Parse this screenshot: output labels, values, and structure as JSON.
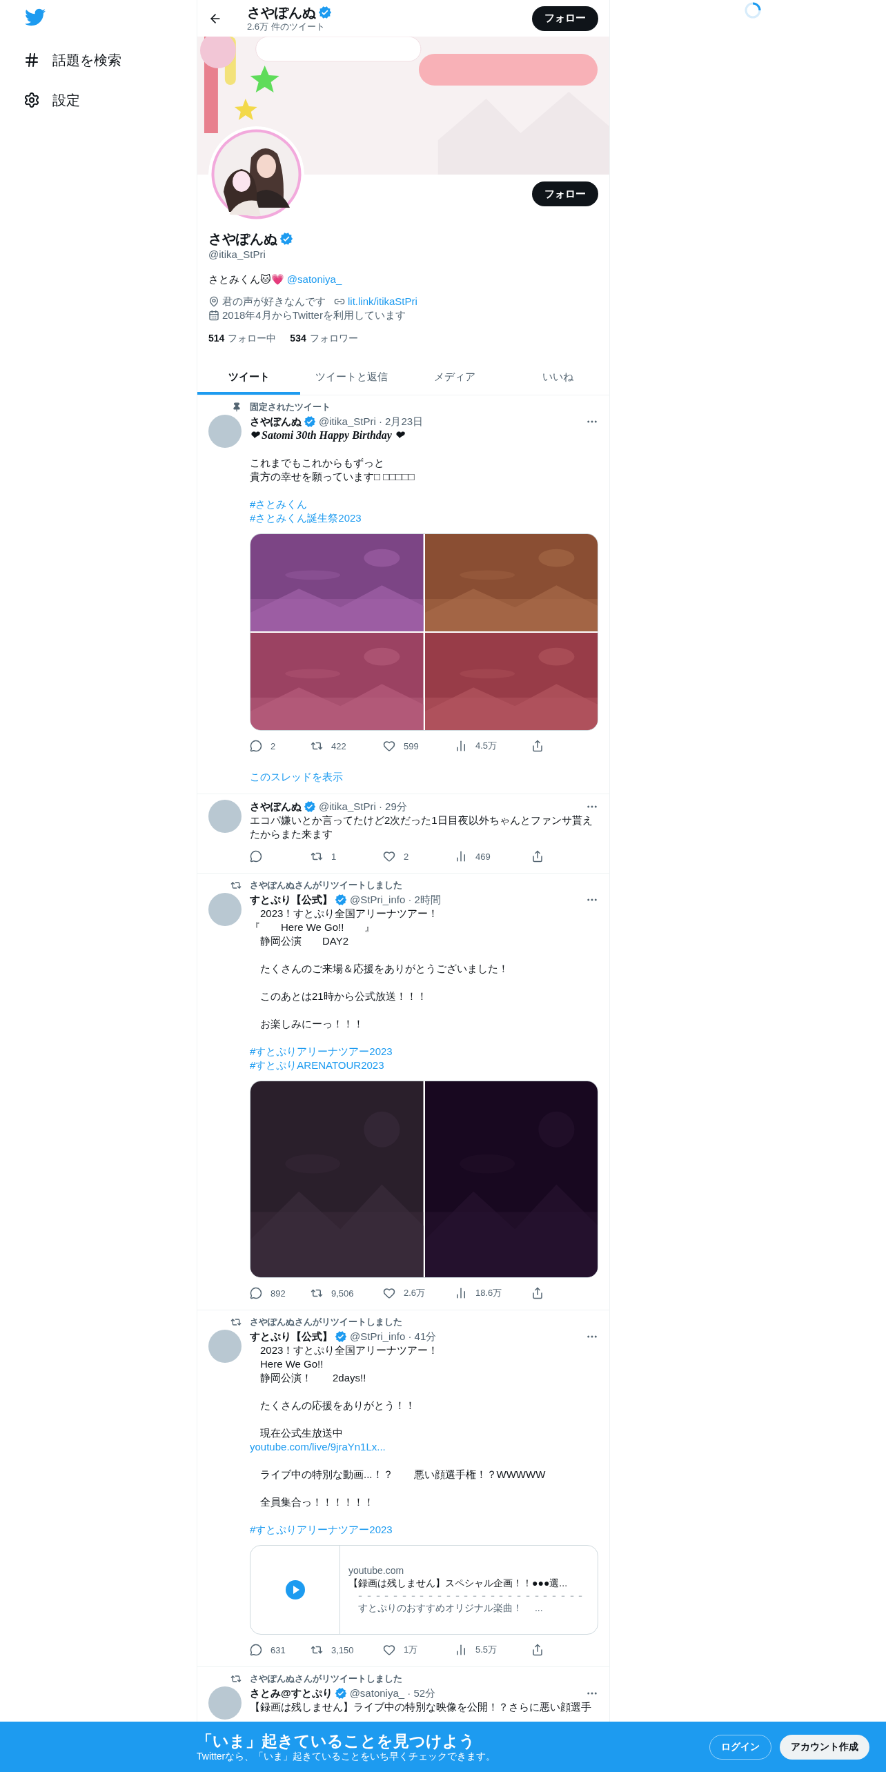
{
  "sidebar": {
    "items": [
      {
        "kind": "hash",
        "label": "話題を検索"
      },
      {
        "kind": "settings",
        "label": "設定"
      }
    ]
  },
  "header": {
    "title": "さやぽんぬ",
    "verified": true,
    "subtitle": "2.6万 件のツイート",
    "follow_button": "フォロー"
  },
  "profile": {
    "follow_button": "フォロー",
    "name": "さやぽんぬ",
    "verified": true,
    "handle": "@itika_StPri",
    "bio": "さとみくん🐱💗 ",
    "bio_mention": "@satoniya_",
    "location": "君の声が好きなんです",
    "website": "lit.link/itikaStPri",
    "joined": "2018年4月からTwitterを利用しています",
    "following_count": "514",
    "following_label": "フォロー中",
    "followers_count": "534",
    "followers_label": "フォロワー"
  },
  "tabs": [
    {
      "label": "ツイート",
      "selected": true
    },
    {
      "label": "ツイートと返信",
      "selected": false
    },
    {
      "label": "メディア",
      "selected": false
    },
    {
      "label": "いいね",
      "selected": false
    }
  ],
  "tweets": [
    {
      "context": {
        "kind": "pinned",
        "text": "固定されたツイート"
      },
      "author": {
        "name": "さやぽんぬ",
        "verified": true
      },
      "meta": "@itika_StPri · 2月23日",
      "paragraphs": [
        [
          {
            "kind": "fancy",
            "text": "❤ Satomi 30th Happy Birthday ❤"
          }
        ],
        [
          {
            "kind": "text",
            "text": "これまでもこれからもずっと"
          },
          {
            "kind": "text",
            "text": "貴方の幸せを願っています□ □□□□□"
          }
        ],
        [
          {
            "kind": "link",
            "text": "#さとみくん"
          },
          {
            "kind": "link",
            "text": "#さとみくん誕生祭2023"
          }
        ]
      ],
      "media": [
        {
          "kind": "picture"
        },
        {
          "kind": "picture"
        },
        {
          "kind": "picture"
        },
        {
          "kind": "picture"
        }
      ],
      "actions": [
        {
          "kind": "reply",
          "count": "2"
        },
        {
          "kind": "retweet",
          "count": "422"
        },
        {
          "kind": "like",
          "count": "599"
        },
        {
          "kind": "views",
          "count": "4.5万"
        },
        {
          "kind": "share"
        }
      ],
      "thread_link": "このスレッドを表示"
    },
    {
      "author": {
        "name": "さやぽんぬ",
        "verified": true
      },
      "meta": "@itika_StPri · 29分",
      "paragraphs": [
        [
          {
            "kind": "text",
            "text": "エコパ嫌いとか言ってたけど2次だった1日目夜以外ちゃんとファンサ貰えたからまた来ます"
          }
        ]
      ],
      "actions": [
        {
          "kind": "reply"
        },
        {
          "kind": "retweet",
          "count": "1"
        },
        {
          "kind": "like",
          "count": "2"
        },
        {
          "kind": "views",
          "count": "469"
        },
        {
          "kind": "share"
        }
      ]
    },
    {
      "context": {
        "kind": "retweet",
        "text": "さやぽんぬさんがリツイートしました"
      },
      "author": {
        "name": "すとぷり【公式】",
        "verified": true
      },
      "meta": "@StPri_info · 2時間",
      "paragraphs": [
        [
          {
            "kind": "text",
            "text": "　2023！すとぷり全国アリーナツアー！"
          },
          {
            "kind": "text",
            "text": "『　　Here We Go!!　　』"
          },
          {
            "kind": "text",
            "text": "　静岡公演　　DAY2"
          }
        ],
        [
          {
            "kind": "text",
            "text": "　たくさんのご来場＆応援をありがとうございました！"
          }
        ],
        [
          {
            "kind": "text",
            "text": "　このあとは21時から公式放送！！！"
          }
        ],
        [
          {
            "kind": "text",
            "text": "　お楽しみにーっ！！！"
          }
        ],
        [
          {
            "kind": "link",
            "text": "#すとぷりアリーナツアー2023"
          },
          {
            "kind": "link",
            "text": "#すとぷりARENATOUR2023"
          }
        ]
      ],
      "media": [
        {
          "kind": "picture"
        },
        {
          "kind": "picture"
        }
      ],
      "actions": [
        {
          "kind": "reply",
          "count": "892"
        },
        {
          "kind": "retweet",
          "count": "9,506"
        },
        {
          "kind": "like",
          "count": "2.6万"
        },
        {
          "kind": "views",
          "count": "18.6万"
        },
        {
          "kind": "share"
        }
      ]
    },
    {
      "context": {
        "kind": "retweet",
        "text": "さやぽんぬさんがリツイートしました"
      },
      "author": {
        "name": "すとぷり【公式】",
        "verified": true
      },
      "meta": "@StPri_info · 41分",
      "paragraphs": [
        [
          {
            "kind": "text",
            "text": "　2023！すとぷり全国アリーナツアー！"
          },
          {
            "kind": "text",
            "text": "　Here We Go!!"
          },
          {
            "kind": "text",
            "text": "　静岡公演！　　2days!!"
          }
        ],
        [
          {
            "kind": "text",
            "text": "　たくさんの応援をありがとう！！"
          }
        ],
        [
          {
            "kind": "text",
            "text": "　現在公式生放送中"
          },
          {
            "kind": "link",
            "text": "youtube.com/live/9jraYn1Lx..."
          }
        ],
        [
          {
            "kind": "text",
            "text": "　ライブ中の特別な動画...！？　　悪い顔選手権！？WWWWW"
          }
        ],
        [
          {
            "kind": "text",
            "text": "　全員集合っ！！！！！！"
          }
        ],
        [
          {
            "kind": "link",
            "text": "#すとぷりアリーナツアー2023"
          }
        ]
      ],
      "card": {
        "domain": "youtube.com",
        "title": "【録画は残しません】スペシャル企画！！●●●選...",
        "divider": "－ － － － － － － － － － － － － － － － － － － － － － － － － －",
        "description": "　すとぷりのおすすめオリジナル楽曲！　 ..."
      },
      "actions": [
        {
          "kind": "reply",
          "count": "631"
        },
        {
          "kind": "retweet",
          "count": "3,150"
        },
        {
          "kind": "like",
          "count": "1万"
        },
        {
          "kind": "views",
          "count": "5.5万"
        },
        {
          "kind": "share"
        }
      ]
    },
    {
      "context": {
        "kind": "retweet",
        "text": "さやぽんぬさんがリツイートしました"
      },
      "author": {
        "name": "さとみ@すとぷり",
        "verified": true
      },
      "meta": "@satoniya_ · 52分",
      "paragraphs": [
        [
          {
            "kind": "text",
            "text": "【録画は残しません】ライブ中の特別な映像を公開！？さらに悪い顔選手"
          }
        ]
      ]
    }
  ],
  "signup_bar": {
    "title": "「いま」起きていることを見つけよう",
    "subtitle": "Twitterなら、「いま」起きていることをいち早くチェックできます。",
    "login_button": "ログイン",
    "signup_button": "アカウント作成"
  }
}
